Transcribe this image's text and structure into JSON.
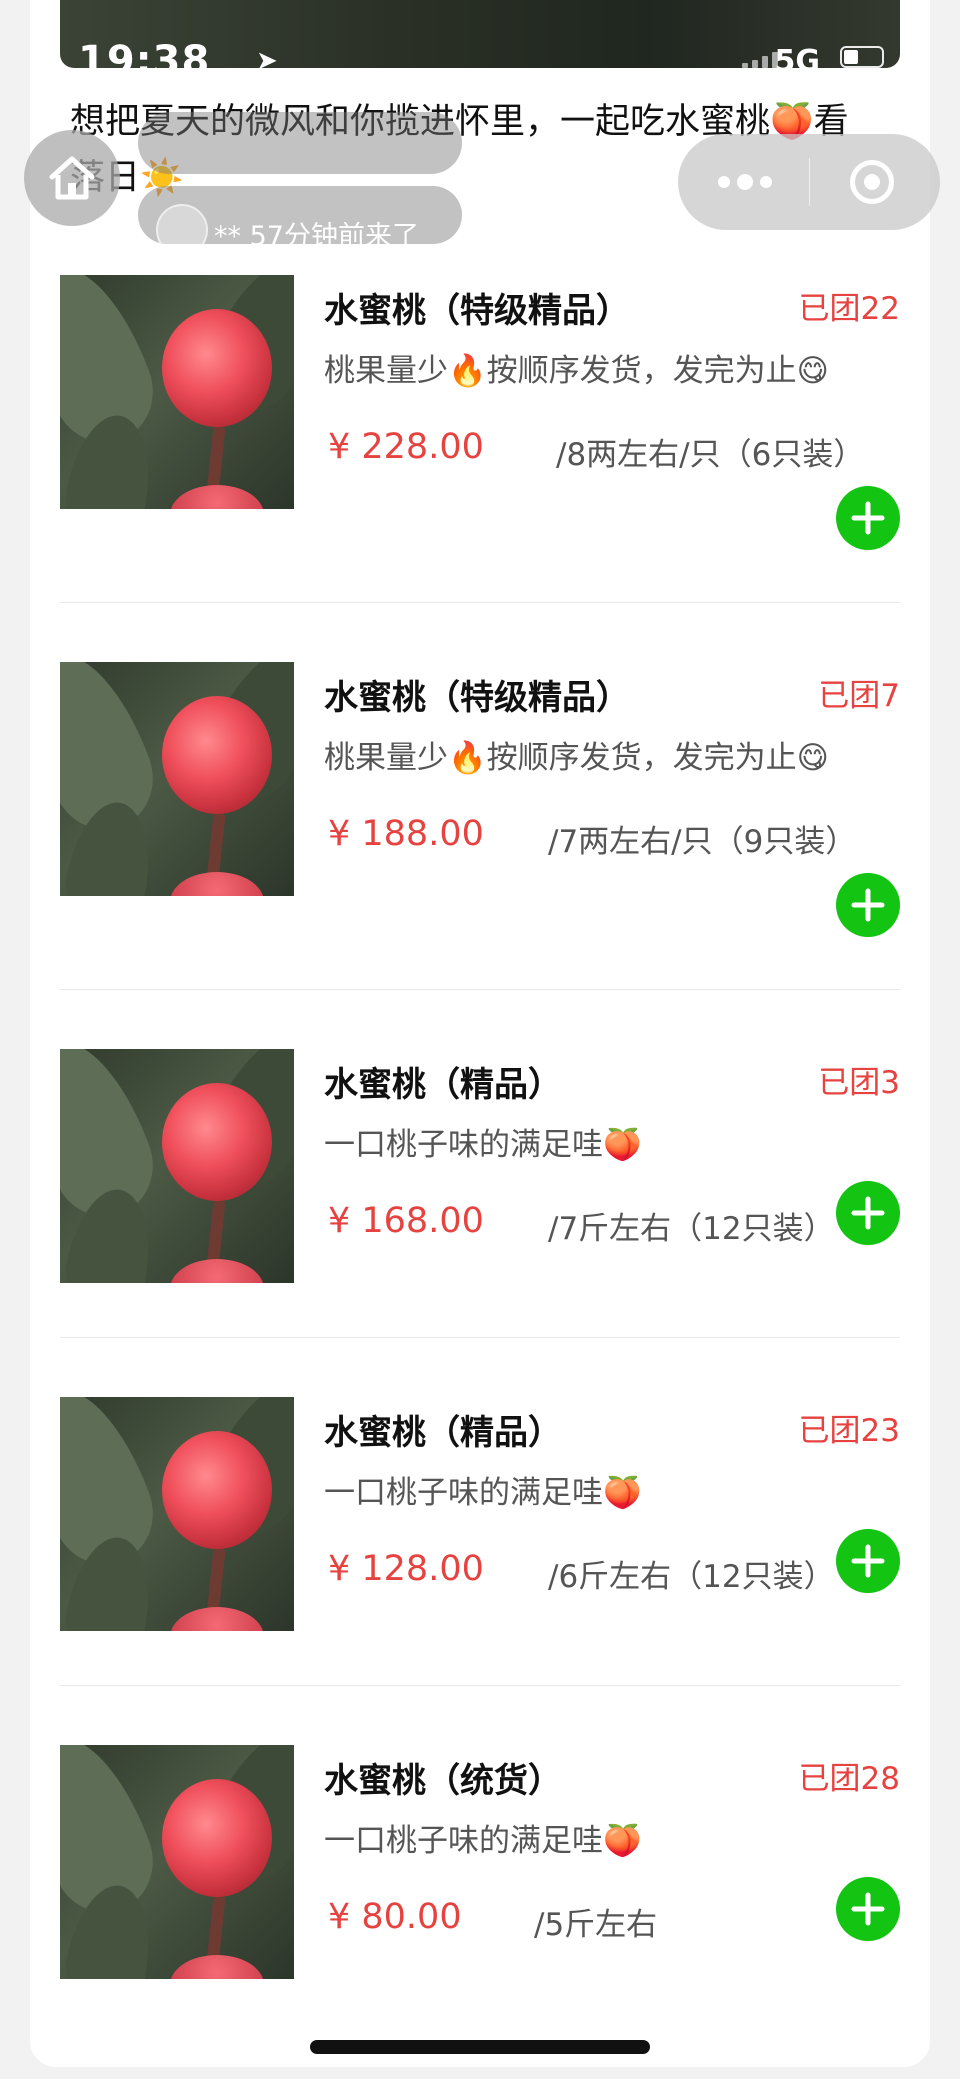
{
  "status_bar": {
    "time": "19:38",
    "network": "5G"
  },
  "intro_text": "想把夏天的微风和你揽进怀里，一起吃水蜜桃🍑看落日☀️",
  "notification": {
    "message": "** 57分钟前来了"
  },
  "icons": {
    "home": "home-icon",
    "more": "more-dots-icon",
    "close_miniprogram": "target-circle-icon",
    "add": "plus-icon",
    "location": "navigation-arrow-icon"
  },
  "colors": {
    "accent_red": "#e64340",
    "add_green": "#13c413"
  },
  "products": [
    {
      "name": "水蜜桃（特级精品）",
      "sold": "已团22",
      "desc": "桃果量少🔥按顺序发货，发完为止😋",
      "price": "¥ 228.00",
      "spec": "/8两左右/只（6只装）"
    },
    {
      "name": "水蜜桃（特级精品）",
      "sold": "已团7",
      "desc": "桃果量少🔥按顺序发货，发完为止😋",
      "price": "¥ 188.00",
      "spec": "/7两左右/只（9只装）"
    },
    {
      "name": "水蜜桃（精品）",
      "sold": "已团3",
      "desc": "一口桃子味的满足哇🍑",
      "price": "¥ 168.00",
      "spec": "/7斤左右（12只装）"
    },
    {
      "name": "水蜜桃（精品）",
      "sold": "已团23",
      "desc": "一口桃子味的满足哇🍑",
      "price": "¥ 128.00",
      "spec": "/6斤左右（12只装）"
    },
    {
      "name": "水蜜桃（统货）",
      "sold": "已团28",
      "desc": "一口桃子味的满足哇🍑",
      "price": "¥ 80.00",
      "spec": "/5斤左右"
    }
  ]
}
